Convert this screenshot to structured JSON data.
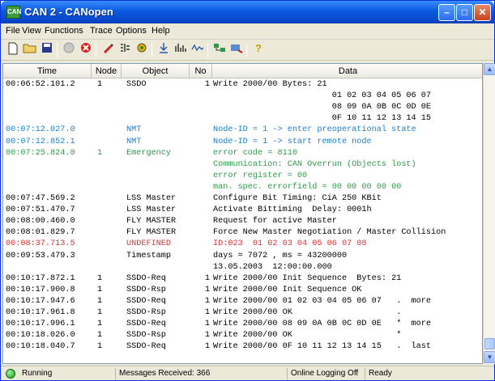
{
  "window": {
    "title": "CAN 2 - CANopen",
    "icon": "can-app-icon",
    "icon_text": "CAN"
  },
  "menu": [
    {
      "label": "File"
    },
    {
      "label": "View"
    },
    {
      "label": "Functions"
    },
    {
      "label": "Trace"
    },
    {
      "label": "Options"
    },
    {
      "label": "Help"
    }
  ],
  "toolbar_icons": [
    "new-file-icon",
    "open-folder-icon",
    "save-icon",
    "disabled-connect-icon",
    "stop-icon",
    "edit-icon",
    "filter-icon",
    "config-icon",
    "download-icon",
    "bar-chart-icon",
    "trace-icon",
    "network-icon",
    "tool-icon",
    "help-icon"
  ],
  "columns": {
    "time": "Time",
    "node": "Node",
    "object": "Object",
    "no": "No",
    "data": "Data"
  },
  "colors": {
    "black": "#000000",
    "blue": "#1a7fd4",
    "green": "#2e9b4a",
    "red": "#e03030"
  },
  "rows": [
    {
      "time": "00:06:52.101.2",
      "node": "1",
      "object": "SSDO",
      "no": "1",
      "data": "Write 2000/00 Bytes: 21",
      "color": "black"
    },
    {
      "time": "",
      "node": "",
      "object": "",
      "no": "",
      "data": "                        01 02 03 04 05 06 07",
      "color": "black"
    },
    {
      "time": "",
      "node": "",
      "object": "",
      "no": "",
      "data": "                        08 09 0A 0B 0C 0D 0E",
      "color": "black"
    },
    {
      "time": "",
      "node": "",
      "object": "",
      "no": "",
      "data": "                        0F 10 11 12 13 14 15",
      "color": "black"
    },
    {
      "time": "00:07:12.027.0",
      "node": "",
      "object": "NMT",
      "no": "",
      "data": "Node-ID = 1 -> enter preoperational state",
      "color": "blue"
    },
    {
      "time": "00:07:12.852.1",
      "node": "",
      "object": "NMT",
      "no": "",
      "data": "Node-ID = 1 -> start remote node",
      "color": "blue"
    },
    {
      "time": "00:07:25.824.0",
      "node": "1",
      "object": "Emergency",
      "no": "",
      "data": "error code = 8110",
      "color": "green"
    },
    {
      "time": "",
      "node": "",
      "object": "",
      "no": "",
      "data": "Communication: CAN Overrun (Objects lost)",
      "color": "green"
    },
    {
      "time": "",
      "node": "",
      "object": "",
      "no": "",
      "data": "error register = 00",
      "color": "green"
    },
    {
      "time": "",
      "node": "",
      "object": "",
      "no": "",
      "data": "man. spec. errorfield = 00 00 00 00 00",
      "color": "green"
    },
    {
      "time": "00:07:47.569.2",
      "node": "",
      "object": "LSS Master",
      "no": "",
      "data": "Configure Bit Timing: CiA 250 KBit",
      "color": "black"
    },
    {
      "time": "00:07:51.470.7",
      "node": "",
      "object": "LSS Master",
      "no": "",
      "data": "Activate Bittiming  Delay: 0001h",
      "color": "black"
    },
    {
      "time": "00:08:00.460.0",
      "node": "",
      "object": "FLY MASTER",
      "no": "",
      "data": "Request for active Master",
      "color": "black"
    },
    {
      "time": "00:08:01.829.7",
      "node": "",
      "object": "FLY MASTER",
      "no": "",
      "data": "Force New Master Negotiation / Master Collision",
      "color": "black"
    },
    {
      "time": "00:08:37.713.5",
      "node": "",
      "object": "UNDEFINED",
      "no": "",
      "data": "ID:023  01 02 03 04 05 06 07 08",
      "color": "red"
    },
    {
      "time": "00:09:53.479.3",
      "node": "",
      "object": "Timestamp",
      "no": "",
      "data": "days = 7072 , ms = 43200000",
      "color": "black"
    },
    {
      "time": "",
      "node": "",
      "object": "",
      "no": "",
      "data": "13.05.2003  12:00:00.000",
      "color": "black"
    },
    {
      "time": "00:10:17.872.1",
      "node": "1",
      "object": "SSDO-Req",
      "no": "1",
      "data": "Write 2000/00 Init Sequence  Bytes: 21",
      "color": "black"
    },
    {
      "time": "00:10:17.900.8",
      "node": "1",
      "object": "SSDO-Rsp",
      "no": "1",
      "data": "Write 2000/00 Init Sequence OK",
      "color": "black"
    },
    {
      "time": "00:10:17.947.6",
      "node": "1",
      "object": "SSDO-Req",
      "no": "1",
      "data": "Write 2000/00 01 02 03 04 05 06 07   .  more",
      "color": "black"
    },
    {
      "time": "00:10:17.961.8",
      "node": "1",
      "object": "SSDO-Rsp",
      "no": "1",
      "data": "Write 2000/00 OK                     .",
      "color": "black"
    },
    {
      "time": "00:10:17.996.1",
      "node": "1",
      "object": "SSDO-Req",
      "no": "1",
      "data": "Write 2000/00 08 09 0A 0B 0C 0D 0E   *  more",
      "color": "black"
    },
    {
      "time": "00:10:18.026.0",
      "node": "1",
      "object": "SSDO-Rsp",
      "no": "1",
      "data": "Write 2000/00 OK                     *",
      "color": "black"
    },
    {
      "time": "00:10:18.040.7",
      "node": "1",
      "object": "SSDO-Req",
      "no": "1",
      "data": "Write 2000/00 0F 10 11 12 13 14 15   .  last",
      "color": "black"
    }
  ],
  "status": {
    "state": "Running",
    "messages": "Messages Received: 366",
    "logging": "Online Logging Off",
    "ready": "Ready"
  }
}
